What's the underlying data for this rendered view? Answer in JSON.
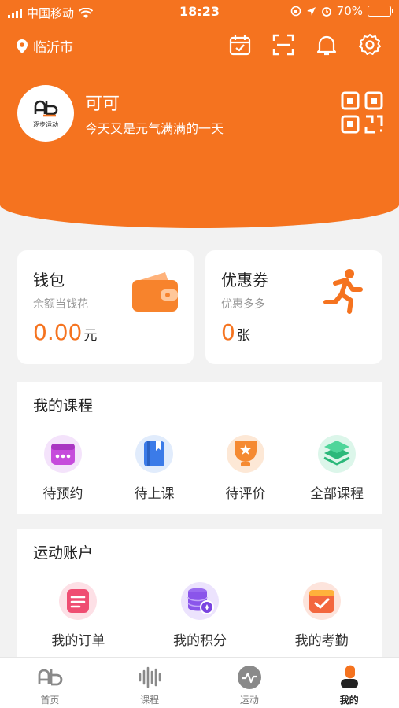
{
  "status_bar": {
    "carrier": "中国移动",
    "time": "18:23",
    "battery": "70%",
    "battery_level": 0.7
  },
  "header": {
    "city": "临沂市",
    "user_name": "可可",
    "motto": "今天又是元气满满的一天",
    "avatar_brand": "逐步运动"
  },
  "wallet": {
    "title": "钱包",
    "subtitle": "余额当钱花",
    "value": "0.00",
    "unit": "元"
  },
  "coupon": {
    "title": "优惠券",
    "subtitle": "优惠多多",
    "value": "0",
    "unit": "张"
  },
  "courses": {
    "title": "我的课程",
    "items": [
      {
        "label": "待预约",
        "icon": "calendar-icon"
      },
      {
        "label": "待上课",
        "icon": "book-icon"
      },
      {
        "label": "待评价",
        "icon": "trophy-icon"
      },
      {
        "label": "全部课程",
        "icon": "layers-icon"
      }
    ]
  },
  "account": {
    "title": "运动账户",
    "items": [
      {
        "label": "我的订单",
        "icon": "order-icon"
      },
      {
        "label": "我的积分",
        "icon": "coins-icon"
      },
      {
        "label": "我的考勤",
        "icon": "attendance-icon"
      }
    ]
  },
  "tabbar": {
    "tabs": [
      {
        "label": "首页",
        "icon": "home-logo-icon"
      },
      {
        "label": "课程",
        "icon": "soundwave-icon"
      },
      {
        "label": "运动",
        "icon": "pulse-icon"
      },
      {
        "label": "我的",
        "icon": "person-icon",
        "active": true
      }
    ]
  },
  "colors": {
    "accent": "#f5731f",
    "background": "#f2f2f2"
  }
}
